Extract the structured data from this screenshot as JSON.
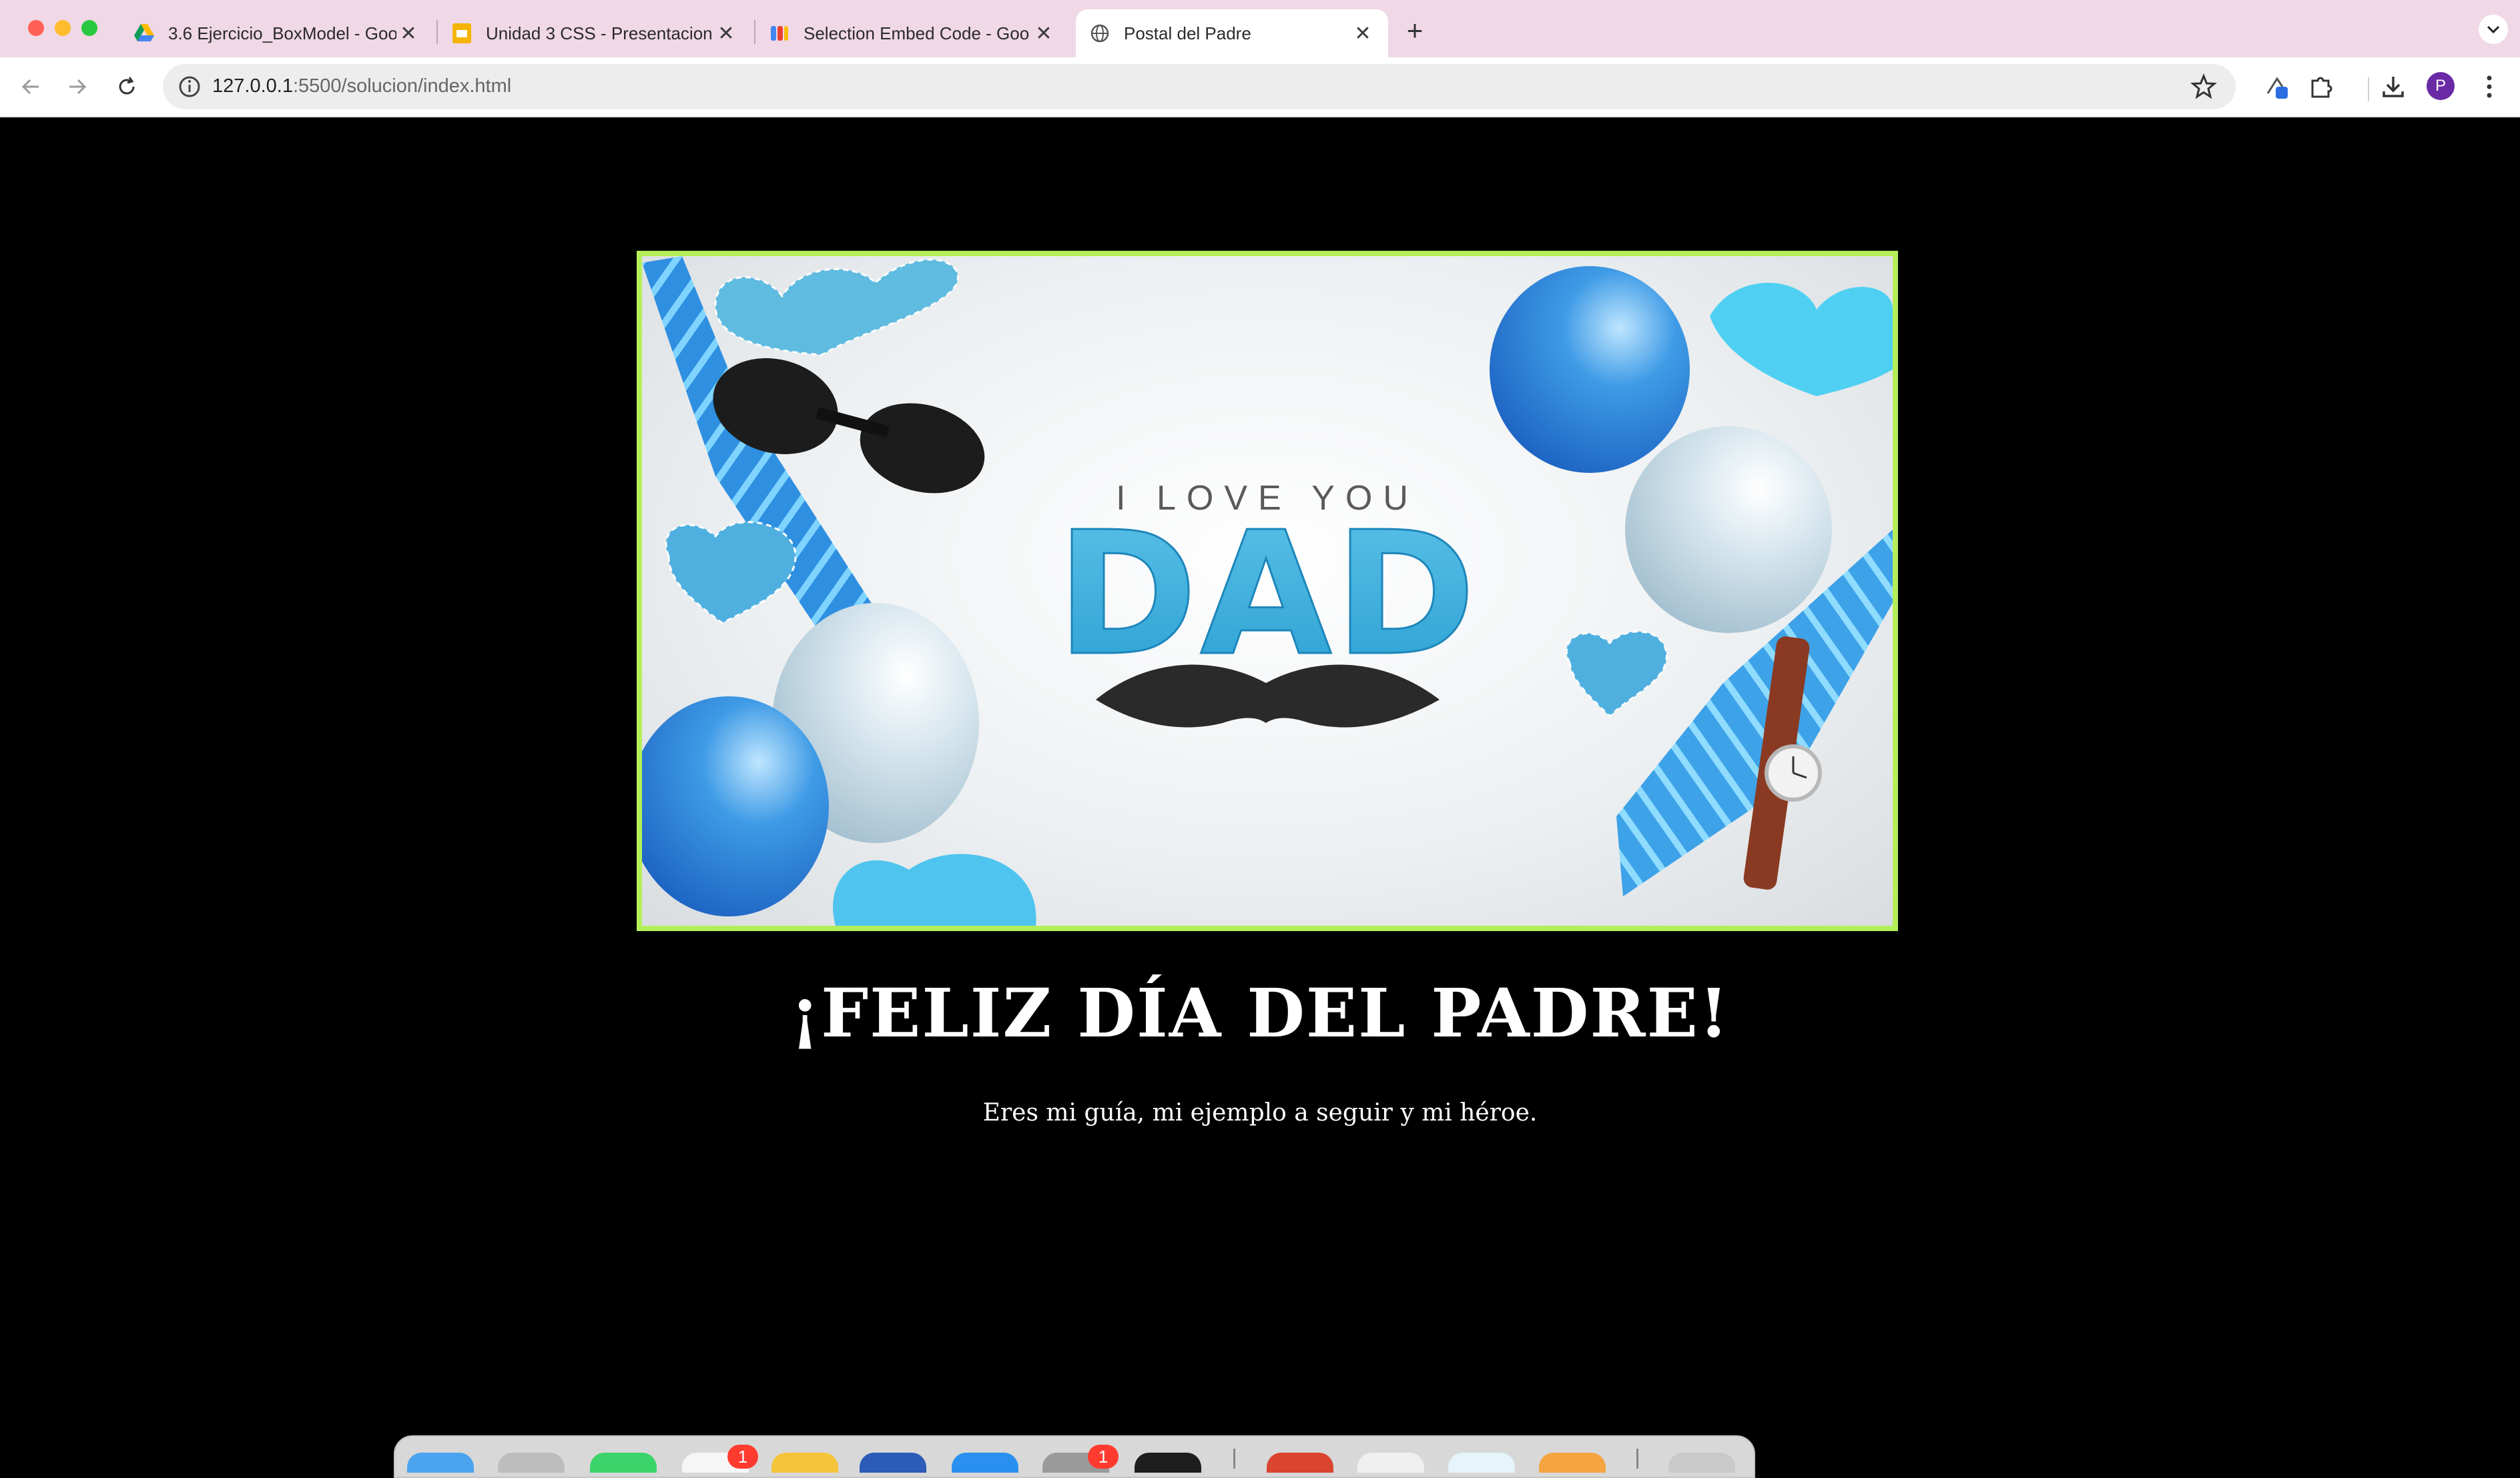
{
  "window": {
    "tabs": [
      {
        "label": "3.6 Ejercicio_BoxModel - Goo",
        "icon": "google-drive-icon",
        "active": false
      },
      {
        "label": "Unidad 3 CSS - Presentacion",
        "icon": "google-slides-icon",
        "active": false
      },
      {
        "label": "Selection Embed Code - Goo",
        "icon": "apps-script-icon",
        "active": false
      },
      {
        "label": "Postal del Padre",
        "icon": "globe-icon",
        "active": true
      }
    ],
    "new_tab_label": "+"
  },
  "toolbar": {
    "url_host": "127.0.0.1",
    "url_rest": ":5500/solucion/index.html",
    "profile_initial": "P"
  },
  "page": {
    "image": {
      "small_text": "I LOVE YOU",
      "big_text": "DAD",
      "border_color": "#b4ef5a"
    },
    "title": "¡FELIZ DÍA DEL PADRE!",
    "subtitle": "Eres mi guía, mi ejemplo a seguir y mi héroe."
  },
  "dock": {
    "badge_1": "1",
    "badge_2": "1"
  }
}
